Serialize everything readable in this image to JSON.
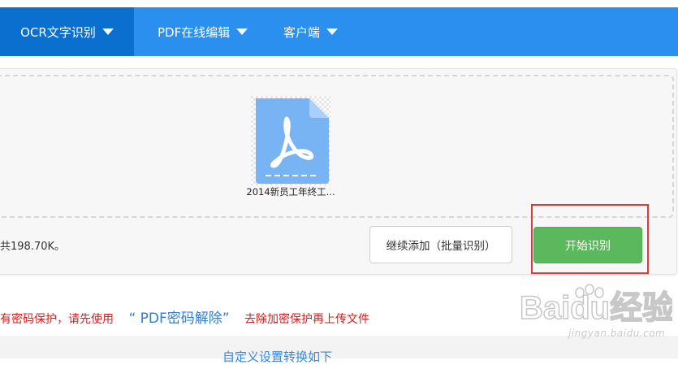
{
  "nav": {
    "items": [
      {
        "label": "OCR文字识别",
        "active": true
      },
      {
        "label": "PDF在线编辑",
        "active": false
      },
      {
        "label": "客户端",
        "active": false
      }
    ]
  },
  "upload": {
    "file_name": "2014新员工年终工...",
    "total_text": "共198.70K。",
    "add_button": "继续添加（批量识别）",
    "start_button": "开始识别"
  },
  "notice": {
    "prefix": "有密码保护，请先使用",
    "link": "“ PDF密码解除”",
    "suffix": "去除加密保护再上传文件"
  },
  "settings": {
    "label": "自定义设置转换如下"
  },
  "watermark": {
    "brand": "Baidu经验",
    "url": "jingyan.baidu.com"
  },
  "colors": {
    "nav_bg": "#2b8ff0",
    "nav_active": "#0b6fd0",
    "start_button": "#5cb85c",
    "highlight": "#e23a3a",
    "notice_text": "#d81e1e",
    "link": "#2b7fd8"
  }
}
